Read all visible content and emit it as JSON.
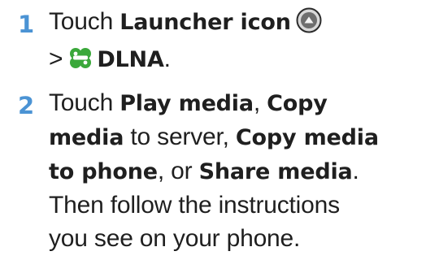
{
  "steps": [
    {
      "number": "1",
      "parts": {
        "a": "Touch ",
        "b": "Launcher icon",
        "c": ">",
        "d": "DLNA",
        "e": "."
      },
      "icons": [
        "launcher-icon",
        "dlna-icon"
      ]
    },
    {
      "number": "2",
      "parts": {
        "a": "Touch ",
        "b": "Play media",
        "c": ", ",
        "d": "Copy",
        "e": "media",
        "f": " to server, ",
        "g": "Copy media",
        "h": "to phone",
        "i": ", or ",
        "j": "Share media",
        "k": ".",
        "l": "Then follow the instructions",
        "m": "you see on your phone."
      }
    }
  ],
  "colors": {
    "step_number": "#4b93d4",
    "text": "#1f1f1f",
    "dlna_icon": "#3aa83a"
  }
}
